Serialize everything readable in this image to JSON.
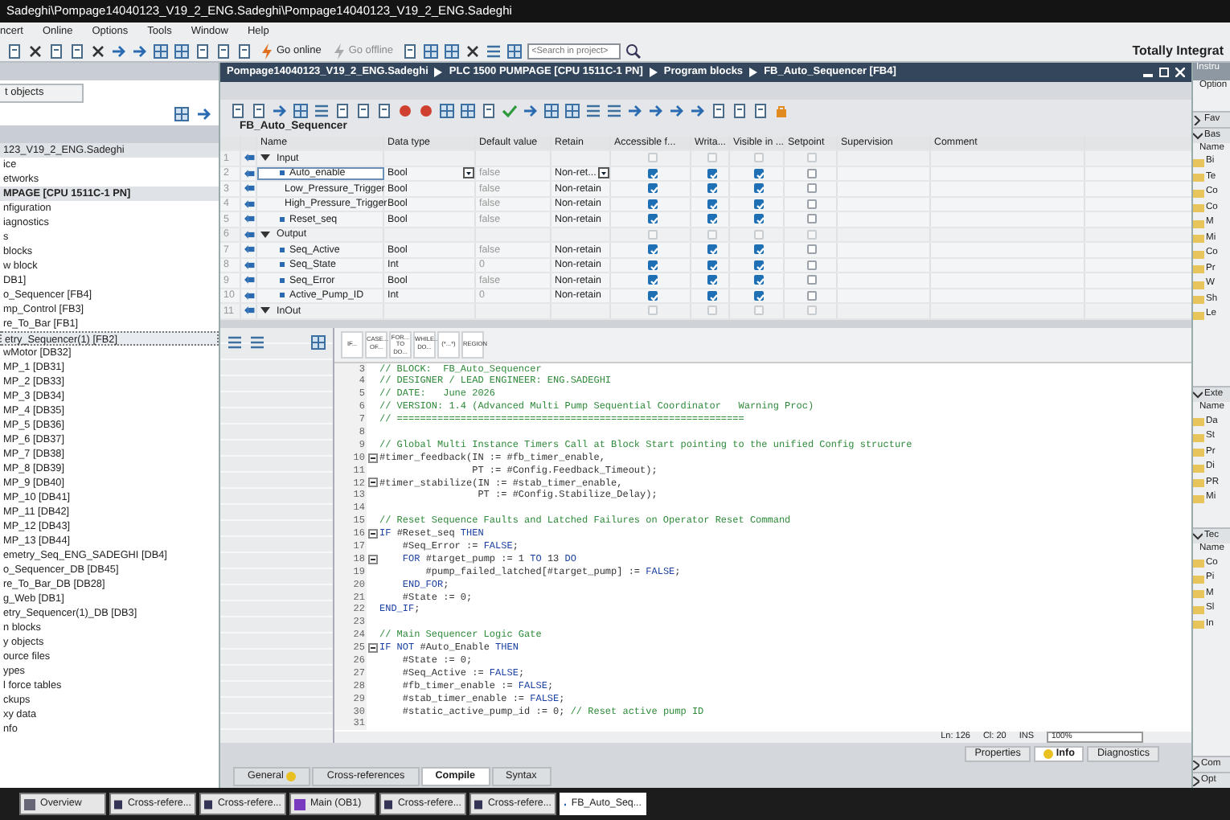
{
  "window": {
    "title": "Sadeghi\\Pompage14040123_V19_2_ENG.Sadeghi\\Pompage14040123_V19_2_ENG.Sadeghi"
  },
  "menu": [
    "ncert",
    "Online",
    "Options",
    "Tools",
    "Window",
    "Help"
  ],
  "toolbar": {
    "go_online": "Go online",
    "go_offline": "Go offline",
    "search": {
      "placeholder": "<Search in project>"
    }
  },
  "brand": "Totally Integrat",
  "project_tree": {
    "tab": "t objects",
    "items": [
      {
        "label": "123_V19_2_ENG.Sadeghi",
        "kind": "project",
        "selected": false
      },
      {
        "label": "ice",
        "kind": "item",
        "selected": false
      },
      {
        "label": "etworks",
        "kind": "item",
        "selected": false
      },
      {
        "label": "MPAGE [CPU 1511C-1 PN]",
        "kind": "device",
        "selected": false
      },
      {
        "label": "nfiguration",
        "kind": "item",
        "selected": false
      },
      {
        "label": "iagnostics",
        "kind": "item",
        "selected": false
      },
      {
        "label": "s",
        "kind": "item",
        "selected": false
      },
      {
        "label": "blocks",
        "kind": "item",
        "selected": false
      },
      {
        "label": "w block",
        "kind": "item",
        "selected": false
      },
      {
        "label": "DB1]",
        "kind": "item",
        "selected": false
      },
      {
        "label": "o_Sequencer [FB4]",
        "kind": "item",
        "selected": false
      },
      {
        "label": "mp_Control [FB3]",
        "kind": "item",
        "selected": false
      },
      {
        "label": "re_To_Bar [FB1]",
        "kind": "item",
        "selected": false
      },
      {
        "label": "etry_Sequencer(1) [FB2]",
        "kind": "item",
        "selected": true
      },
      {
        "label": "wMotor [DB32]",
        "kind": "item",
        "selected": false
      },
      {
        "label": "MP_1 [DB31]",
        "kind": "item",
        "selected": false
      },
      {
        "label": "MP_2 [DB33]",
        "kind": "item",
        "selected": false
      },
      {
        "label": "MP_3 [DB34]",
        "kind": "item",
        "selected": false
      },
      {
        "label": "MP_4 [DB35]",
        "kind": "item",
        "selected": false
      },
      {
        "label": "MP_5 [DB36]",
        "kind": "item",
        "selected": false
      },
      {
        "label": "MP_6 [DB37]",
        "kind": "item",
        "selected": false
      },
      {
        "label": "MP_7 [DB38]",
        "kind": "item",
        "selected": false
      },
      {
        "label": "MP_8 [DB39]",
        "kind": "item",
        "selected": false
      },
      {
        "label": "MP_9 [DB40]",
        "kind": "item",
        "selected": false
      },
      {
        "label": "MP_10 [DB41]",
        "kind": "item",
        "selected": false
      },
      {
        "label": "MP_11 [DB42]",
        "kind": "item",
        "selected": false
      },
      {
        "label": "MP_12 [DB43]",
        "kind": "item",
        "selected": false
      },
      {
        "label": "MP_13 [DB44]",
        "kind": "item",
        "selected": false
      },
      {
        "label": "emetry_Seq_ENG_SADEGHI [DB4]",
        "kind": "item",
        "selected": false
      },
      {
        "label": "o_Sequencer_DB [DB45]",
        "kind": "item",
        "selected": false
      },
      {
        "label": "re_To_Bar_DB [DB28]",
        "kind": "item",
        "selected": false
      },
      {
        "label": "g_Web [DB1]",
        "kind": "item",
        "selected": false
      },
      {
        "label": "etry_Sequencer(1)_DB [DB3]",
        "kind": "item",
        "selected": false
      },
      {
        "label": "n blocks",
        "kind": "item",
        "selected": false
      },
      {
        "label": "y objects",
        "kind": "item",
        "selected": false
      },
      {
        "label": "ource files",
        "kind": "item",
        "selected": false
      },
      {
        "label": "ypes",
        "kind": "item",
        "selected": false
      },
      {
        "label": "l force tables",
        "kind": "item",
        "selected": false
      },
      {
        "label": "ckups",
        "kind": "item",
        "selected": false
      },
      {
        "label": "xy data",
        "kind": "item",
        "selected": false
      },
      {
        "label": "nfo",
        "kind": "item",
        "selected": false
      }
    ]
  },
  "editor": {
    "breadcrumb": [
      "Pompage14040123_V19_2_ENG.Sadeghi",
      "PLC 1500 PUMPAGE [CPU 1511C-1 PN]",
      "Program blocks",
      "FB_Auto_Sequencer [FB4]"
    ],
    "block_title": "FB_Auto_Sequencer",
    "columns": [
      "Name",
      "Data type",
      "Default value",
      "Retain",
      "Accessible f...",
      "Writa...",
      "Visible in ...",
      "Setpoint",
      "Supervision",
      "Comment"
    ],
    "rows": [
      {
        "num": "1",
        "kind": "section",
        "name": "Input",
        "expanded": true,
        "accessible": false,
        "writable": false,
        "visible": false,
        "setpoint": false,
        "selected": false
      },
      {
        "num": "2",
        "kind": "variable",
        "name": "Auto_enable",
        "data_type": "Bool",
        "default": "false",
        "retain": "Non-ret...",
        "accessible": true,
        "writable": true,
        "visible": true,
        "setpoint": false,
        "selected": true
      },
      {
        "num": "3",
        "kind": "variable",
        "name": "Low_Pressure_Trigger",
        "data_type": "Bool",
        "default": "false",
        "retain": "Non-retain",
        "accessible": true,
        "writable": true,
        "visible": true,
        "setpoint": false,
        "selected": false
      },
      {
        "num": "4",
        "kind": "variable",
        "name": "High_Pressure_Trigger",
        "data_type": "Bool",
        "default": "false",
        "retain": "Non-retain",
        "accessible": true,
        "writable": true,
        "visible": true,
        "setpoint": false,
        "selected": false
      },
      {
        "num": "5",
        "kind": "variable",
        "name": "Reset_seq",
        "data_type": "Bool",
        "default": "false",
        "retain": "Non-retain",
        "accessible": true,
        "writable": true,
        "visible": true,
        "setpoint": false,
        "selected": false
      },
      {
        "num": "6",
        "kind": "section",
        "name": "Output",
        "expanded": true,
        "accessible": false,
        "writable": false,
        "visible": false,
        "setpoint": false,
        "selected": false
      },
      {
        "num": "7",
        "kind": "variable",
        "name": "Seq_Active",
        "data_type": "Bool",
        "default": "false",
        "retain": "Non-retain",
        "accessible": true,
        "writable": true,
        "visible": true,
        "setpoint": false,
        "selected": false
      },
      {
        "num": "8",
        "kind": "variable",
        "name": "Seq_State",
        "data_type": "Int",
        "default": "0",
        "retain": "Non-retain",
        "accessible": true,
        "writable": true,
        "visible": true,
        "setpoint": false,
        "selected": false
      },
      {
        "num": "9",
        "kind": "variable",
        "name": "Seq_Error",
        "data_type": "Bool",
        "default": "false",
        "retain": "Non-retain",
        "accessible": true,
        "writable": true,
        "visible": true,
        "setpoint": false,
        "selected": false
      },
      {
        "num": "10",
        "kind": "variable",
        "name": "Active_Pump_ID",
        "data_type": "Int",
        "default": "0",
        "retain": "Non-retain",
        "accessible": true,
        "writable": true,
        "visible": true,
        "setpoint": false,
        "selected": false
      },
      {
        "num": "11",
        "kind": "section",
        "name": "InOut",
        "expanded": true,
        "accessible": false,
        "writable": false,
        "visible": false,
        "setpoint": false,
        "selected": false
      }
    ],
    "snippets": [
      "IF...",
      "CASE... OF...",
      "FOR... TO DO...",
      "WHILE... DO...",
      "(*...*)",
      "REGION"
    ],
    "code": [
      {
        "num": "3",
        "fold": false,
        "parts": [
          {
            "kind": "comment",
            "text": "// BLOCK:  FB_Auto_Sequencer"
          }
        ]
      },
      {
        "num": "4",
        "fold": false,
        "parts": [
          {
            "kind": "comment",
            "text": "// DESIGNER / LEAD ENGINEER: ENG.SADEGHI"
          }
        ]
      },
      {
        "num": "5",
        "fold": false,
        "parts": [
          {
            "kind": "comment",
            "text": "// DATE:   June 2026"
          }
        ]
      },
      {
        "num": "6",
        "fold": false,
        "parts": [
          {
            "kind": "comment",
            "text": "// VERSION: 1.4 (Advanced Multi Pump Sequential Coordinator   Warning Proc)"
          }
        ]
      },
      {
        "num": "7",
        "fold": false,
        "parts": [
          {
            "kind": "comment",
            "text": "// ============================================================"
          }
        ]
      },
      {
        "num": "8",
        "fold": false
      },
      {
        "num": "9",
        "fold": false,
        "parts": [
          {
            "kind": "comment",
            "text": "// Global Multi Instance Timers Call at Block Start pointing to the unified Config structure"
          }
        ]
      },
      {
        "num": "10",
        "fold": true,
        "parts": [
          {
            "kind": "code",
            "text": "#timer_feedback(IN := #fb_timer_enable,"
          }
        ]
      },
      {
        "num": "11",
        "fold": false,
        "parts": [
          {
            "kind": "code",
            "text": "                PT := #Config.Feedback_Timeout);"
          }
        ]
      },
      {
        "num": "12",
        "fold": true,
        "parts": [
          {
            "kind": "code",
            "text": "#timer_stabilize(IN := #stab_timer_enable,"
          }
        ]
      },
      {
        "num": "13",
        "fold": false,
        "parts": [
          {
            "kind": "code",
            "text": "                 PT := #Config.Stabilize_Delay);"
          }
        ]
      },
      {
        "num": "14",
        "fold": false
      },
      {
        "num": "15",
        "fold": false,
        "parts": [
          {
            "kind": "comment",
            "text": "// Reset Sequence Faults and Latched Failures on Operator Reset Command"
          }
        ]
      },
      {
        "num": "16",
        "fold": true,
        "parts": [
          {
            "kind": "keyword",
            "text": "IF "
          },
          {
            "kind": "code",
            "text": "#Reset_seq "
          },
          {
            "kind": "keyword",
            "text": "THEN"
          }
        ]
      },
      {
        "num": "17",
        "fold": false,
        "parts": [
          {
            "kind": "code",
            "text": "    #Seq_Error := "
          },
          {
            "kind": "keyword",
            "text": "FALSE"
          },
          {
            "kind": "code",
            "text": ";"
          }
        ]
      },
      {
        "num": "18",
        "fold": true,
        "parts": [
          {
            "kind": "keyword",
            "text": "    FOR "
          },
          {
            "kind": "code",
            "text": "#target_pump := 1 "
          },
          {
            "kind": "keyword",
            "text": "TO "
          },
          {
            "kind": "code",
            "text": "13 "
          },
          {
            "kind": "keyword",
            "text": "DO"
          }
        ]
      },
      {
        "num": "19",
        "fold": false,
        "parts": [
          {
            "kind": "code",
            "text": "        #pump_failed_latched[#target_pump] := "
          },
          {
            "kind": "keyword",
            "text": "FALSE"
          },
          {
            "kind": "code",
            "text": ";"
          }
        ]
      },
      {
        "num": "20",
        "fold": false,
        "parts": [
          {
            "kind": "keyword",
            "text": "    END_FOR"
          },
          {
            "kind": "code",
            "text": ";"
          }
        ]
      },
      {
        "num": "21",
        "fold": false,
        "parts": [
          {
            "kind": "code",
            "text": "    #State := 0;"
          }
        ]
      },
      {
        "num": "22",
        "fold": false,
        "parts": [
          {
            "kind": "keyword",
            "text": "END_IF"
          },
          {
            "kind": "code",
            "text": ";"
          }
        ]
      },
      {
        "num": "23",
        "fold": false
      },
      {
        "num": "24",
        "fold": false,
        "parts": [
          {
            "kind": "comment",
            "text": "// Main Sequencer Logic Gate"
          }
        ]
      },
      {
        "num": "25",
        "fold": true,
        "parts": [
          {
            "kind": "keyword",
            "text": "IF NOT "
          },
          {
            "kind": "code",
            "text": "#Auto_Enable "
          },
          {
            "kind": "keyword",
            "text": "THEN"
          }
        ]
      },
      {
        "num": "26",
        "fold": false,
        "parts": [
          {
            "kind": "code",
            "text": "    #State := 0;"
          }
        ]
      },
      {
        "num": "27",
        "fold": false,
        "parts": [
          {
            "kind": "code",
            "text": "    #Seq_Active := "
          },
          {
            "kind": "keyword",
            "text": "FALSE"
          },
          {
            "kind": "code",
            "text": ";"
          }
        ]
      },
      {
        "num": "28",
        "fold": false,
        "parts": [
          {
            "kind": "code",
            "text": "    #fb_timer_enable := "
          },
          {
            "kind": "keyword",
            "text": "FALSE"
          },
          {
            "kind": "code",
            "text": ";"
          }
        ]
      },
      {
        "num": "29",
        "fold": false,
        "parts": [
          {
            "kind": "code",
            "text": "    #stab_timer_enable := "
          },
          {
            "kind": "keyword",
            "text": "FALSE"
          },
          {
            "kind": "code",
            "text": ";"
          }
        ]
      },
      {
        "num": "30",
        "fold": false,
        "parts": [
          {
            "kind": "code",
            "text": "    #static_active_pump_id := 0; "
          },
          {
            "kind": "comment",
            "text": "// Reset active pump ID"
          }
        ]
      },
      {
        "num": "31",
        "fold": false
      }
    ],
    "status": {
      "line": "Ln: 126",
      "column": "Cl: 20",
      "mode": "INS",
      "zoom": "100%"
    }
  },
  "inspector_tabs": [
    {
      "label": "Properties",
      "selected": false,
      "warning": false
    },
    {
      "label": "Info",
      "selected": true,
      "warning": true
    },
    {
      "label": "Diagnostics",
      "selected": false,
      "warning": false
    }
  ],
  "info_tabs": [
    {
      "label": "General",
      "selected": false,
      "warning": true
    },
    {
      "label": "Cross-references",
      "selected": false,
      "warning": false
    },
    {
      "label": "Compile",
      "selected": true,
      "warning": false
    },
    {
      "label": "Syntax",
      "selected": false,
      "warning": false
    }
  ],
  "task_card": {
    "title": "Instru",
    "options": "Option",
    "sections": [
      {
        "label": "Fav",
        "expanded": false
      },
      {
        "label": "Bas",
        "expanded": true,
        "header": "Name",
        "items": [
          "Bi",
          "Te",
          "Co",
          "Co",
          "M",
          "Mi",
          "Co",
          "Pr",
          "W",
          "Sh",
          "Le"
        ]
      },
      {
        "label": "Exte",
        "expanded": true,
        "header": "Name",
        "items": [
          "Da",
          "St",
          "Pr",
          "Di",
          "PR",
          "Mi"
        ]
      },
      {
        "label": "Tec",
        "expanded": true,
        "header": "Name",
        "items": [
          "Co",
          "Pi",
          "M",
          "Sl",
          "In"
        ]
      }
    ],
    "bottom": [
      "Com",
      "Opt"
    ]
  },
  "taskbar": [
    {
      "label": "Overview",
      "kind": "overview",
      "selected": false
    },
    {
      "label": "Cross-refere...",
      "kind": "xref",
      "selected": false
    },
    {
      "label": "Cross-refere...",
      "kind": "xref",
      "selected": false
    },
    {
      "label": "Main (OB1)",
      "kind": "ob",
      "selected": false
    },
    {
      "label": "Cross-refere...",
      "kind": "xref",
      "selected": false
    },
    {
      "label": "Cross-refere...",
      "kind": "xref",
      "selected": false
    },
    {
      "label": "FB_Auto_Seq...",
      "kind": "fb",
      "selected": true
    }
  ]
}
